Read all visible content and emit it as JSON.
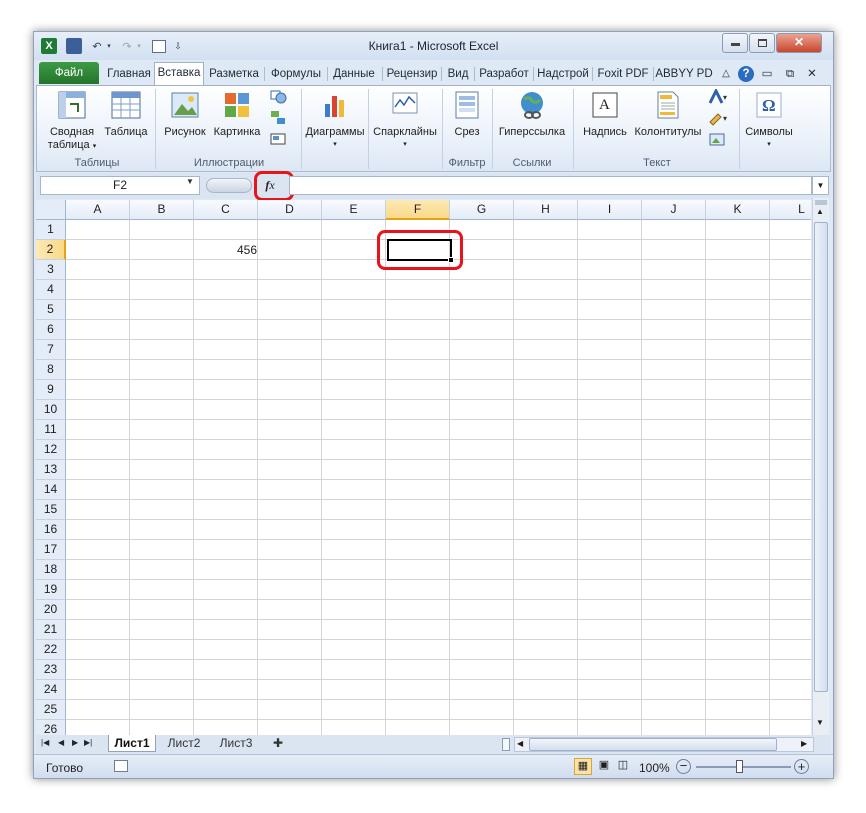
{
  "window": {
    "title": "Книга1  -  Microsoft Excel",
    "controls": {
      "minimize": "▭",
      "restore": "□",
      "close": "✕"
    }
  },
  "qat": {
    "app_icon": "X",
    "save": "💾",
    "undo": "↶",
    "redo": "↷",
    "more": "⇩"
  },
  "tabs": [
    "Файл",
    "Главная",
    "Вставка",
    "Разметка",
    "Формулы",
    "Данные",
    "Рецензир",
    "Вид",
    "Разработ",
    "Надстрой",
    "Foxit PDF",
    "ABBYY PD"
  ],
  "active_tab": "Вставка",
  "ribbon": {
    "groups": {
      "tables": "Таблицы",
      "illustrations": "Иллюстрации",
      "filter": "Фильтр",
      "links": "Ссылки",
      "text": "Текст"
    },
    "buttons": {
      "pivot_line1": "Сводная",
      "pivot_line2": "таблица",
      "table": "Таблица",
      "picture": "Рисунок",
      "clipart": "Картинка",
      "charts": "Диаграммы",
      "sparklines": "Спарклайны",
      "slicer": "Срез",
      "hyperlink": "Гиперссылка",
      "textbox": "Надпись",
      "headerfooter": "Колонтитулы",
      "symbols": "Символы"
    }
  },
  "formula_bar": {
    "name_box": "F2",
    "fx_label": "fx",
    "value": ""
  },
  "columns": [
    "A",
    "B",
    "C",
    "D",
    "E",
    "F",
    "G",
    "H",
    "I",
    "J",
    "K",
    "L"
  ],
  "selected_column": "F",
  "rows": [
    "1",
    "2",
    "3",
    "4",
    "5",
    "6",
    "7",
    "8",
    "9",
    "10",
    "11",
    "12",
    "13",
    "14",
    "15",
    "16",
    "17",
    "18",
    "19",
    "20",
    "21",
    "22",
    "23",
    "24",
    "25",
    "26"
  ],
  "selected_row": "2",
  "cells": {
    "C2": "456"
  },
  "sheets": [
    "Лист1",
    "Лист2",
    "Лист3"
  ],
  "active_sheet": "Лист1",
  "status": {
    "ready": "Готово",
    "zoom": "100%"
  },
  "colors": {
    "file_tab": "#2e8a36",
    "highlight": "#e8141b",
    "selection": "#000000",
    "header_selected": "#f9d989"
  }
}
